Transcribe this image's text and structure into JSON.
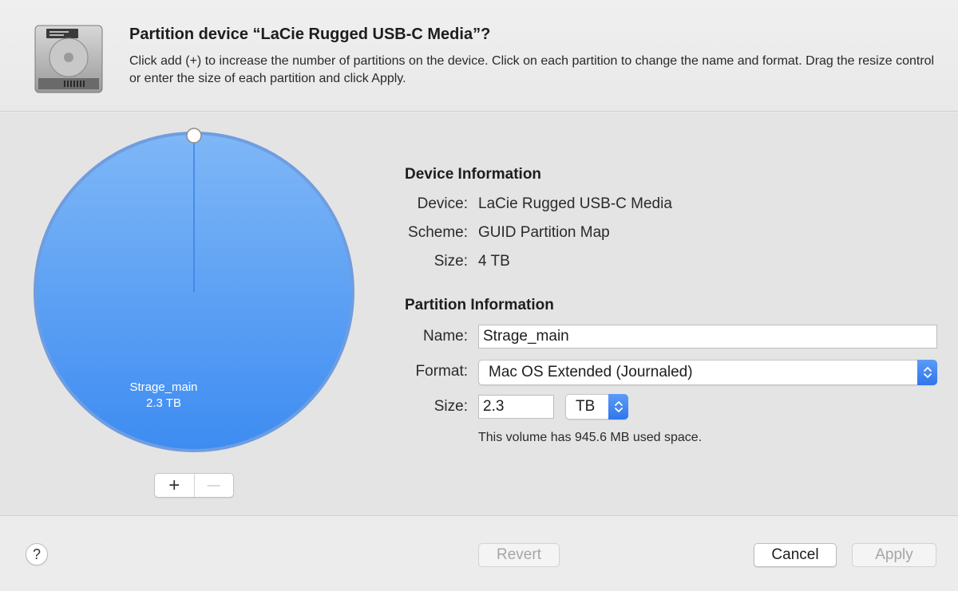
{
  "dialog": {
    "title": "Partition device “LaCie Rugged USB-C Media”?",
    "description": "Click add (+) to increase the number of partitions on the device. Click on each partition to change the name and format. Drag the resize control or enter the size of each partition and click Apply.",
    "icon": "external-hard-drive-icon"
  },
  "pie": {
    "partition_name": "Strage_main",
    "partition_size": "2.3 TB",
    "fill_color": "#4d98f5",
    "add_symbol": "+",
    "remove_symbol": "—"
  },
  "device_info": {
    "heading": "Device Information",
    "device_label": "Device:",
    "device_value": "LaCie Rugged USB-C Media",
    "scheme_label": "Scheme:",
    "scheme_value": "GUID Partition Map",
    "size_label": "Size:",
    "size_value": "4 TB"
  },
  "partition_info": {
    "heading": "Partition Information",
    "name_label": "Name:",
    "name_value": "Strage_main",
    "format_label": "Format:",
    "format_value": "Mac OS Extended (Journaled)",
    "size_label": "Size:",
    "size_value": "2.3",
    "unit_value": "TB",
    "used_space_note": "This volume has 945.6 MB used space."
  },
  "footer": {
    "help_symbol": "?",
    "revert_label": "Revert",
    "cancel_label": "Cancel",
    "apply_label": "Apply"
  },
  "colors": {
    "accent": "#2f76ec",
    "pie_fill": "#4d98f5"
  }
}
